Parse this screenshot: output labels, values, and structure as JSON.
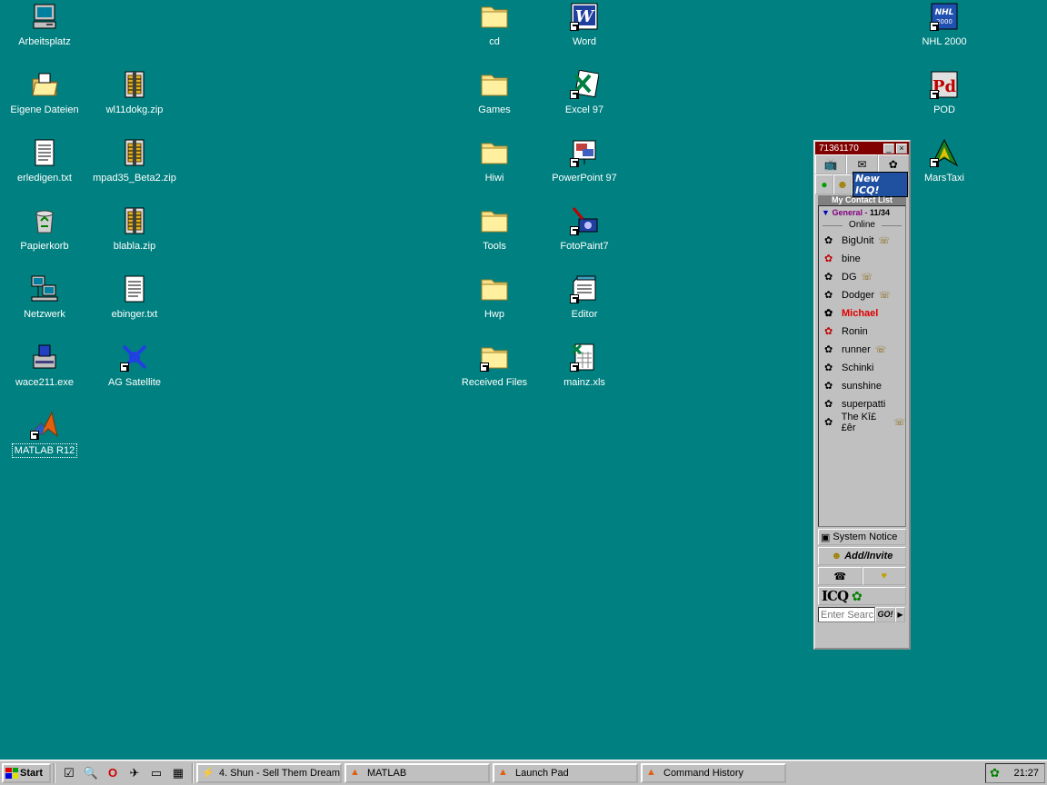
{
  "desktop": {
    "background": "#008080",
    "icons": [
      {
        "label": "Arbeitsplatz",
        "icon": "computer-icon"
      },
      {
        "label": "Eigene Dateien",
        "icon": "folder-open-icon"
      },
      {
        "label": "erledigen.txt",
        "icon": "text-file-icon"
      },
      {
        "label": "Papierkorb",
        "icon": "recycle-bin-icon"
      },
      {
        "label": "Netzwerk",
        "icon": "network-icon"
      },
      {
        "label": "wace211.exe",
        "icon": "installer-icon"
      },
      {
        "label": "MATLAB R12",
        "icon": "matlab-icon"
      },
      {
        "label": "wl11dokg.zip",
        "icon": "zip-icon"
      },
      {
        "label": "mpad35_Beta2.zip",
        "icon": "zip-icon"
      },
      {
        "label": "blabla.zip",
        "icon": "zip-icon"
      },
      {
        "label": "ebinger.txt",
        "icon": "text-file-icon"
      },
      {
        "label": "AG Satellite",
        "icon": "satellite-icon"
      },
      {
        "label": "cd",
        "icon": "folder-icon"
      },
      {
        "label": "Games",
        "icon": "folder-icon"
      },
      {
        "label": "Hiwi",
        "icon": "folder-icon"
      },
      {
        "label": "Tools",
        "icon": "folder-icon"
      },
      {
        "label": "Hwp",
        "icon": "folder-icon"
      },
      {
        "label": "Received Files",
        "icon": "folder-icon"
      },
      {
        "label": "Word",
        "icon": "word-icon"
      },
      {
        "label": "Excel 97",
        "icon": "excel-icon"
      },
      {
        "label": "PowerPoint 97",
        "icon": "powerpoint-icon"
      },
      {
        "label": "FotoPaint7",
        "icon": "fotopaint-icon"
      },
      {
        "label": "Editor",
        "icon": "notepad-icon"
      },
      {
        "label": "mainz.xls",
        "icon": "xls-file-icon"
      },
      {
        "label": "NHL 2000",
        "icon": "nhl-icon"
      },
      {
        "label": "POD",
        "icon": "pod-icon"
      },
      {
        "label": "MarsTaxi",
        "icon": "marstaxi-icon"
      }
    ]
  },
  "icq": {
    "title": "71361170",
    "new_icq": "New ICQ!",
    "contact_list_header": "My Contact List",
    "group_name": "General - ",
    "group_count": "11/34",
    "online_label": "Online",
    "contacts": [
      {
        "name": "BigUnit",
        "phone": true
      },
      {
        "name": "bine",
        "phone": false
      },
      {
        "name": "DG",
        "phone": true
      },
      {
        "name": "Dodger",
        "phone": true
      },
      {
        "name": "Michael",
        "phone": false
      },
      {
        "name": "Ronin",
        "phone": false
      },
      {
        "name": "runner",
        "phone": true
      },
      {
        "name": "Schinki",
        "phone": false
      },
      {
        "name": "sunshine",
        "phone": false
      },
      {
        "name": "superpatti",
        "phone": false
      },
      {
        "name": "The Kî££êr",
        "phone": true
      }
    ],
    "system_notice": "System Notice",
    "add_invite": "Add/Invite",
    "logo": "ICQ",
    "search_placeholder": "Enter Searc",
    "go": "GO!"
  },
  "taskbar": {
    "start": "Start",
    "tasks": [
      "4. Shun - Sell Them Dream...",
      "MATLAB",
      "Launch Pad",
      "Command History"
    ],
    "clock": "21:27"
  }
}
